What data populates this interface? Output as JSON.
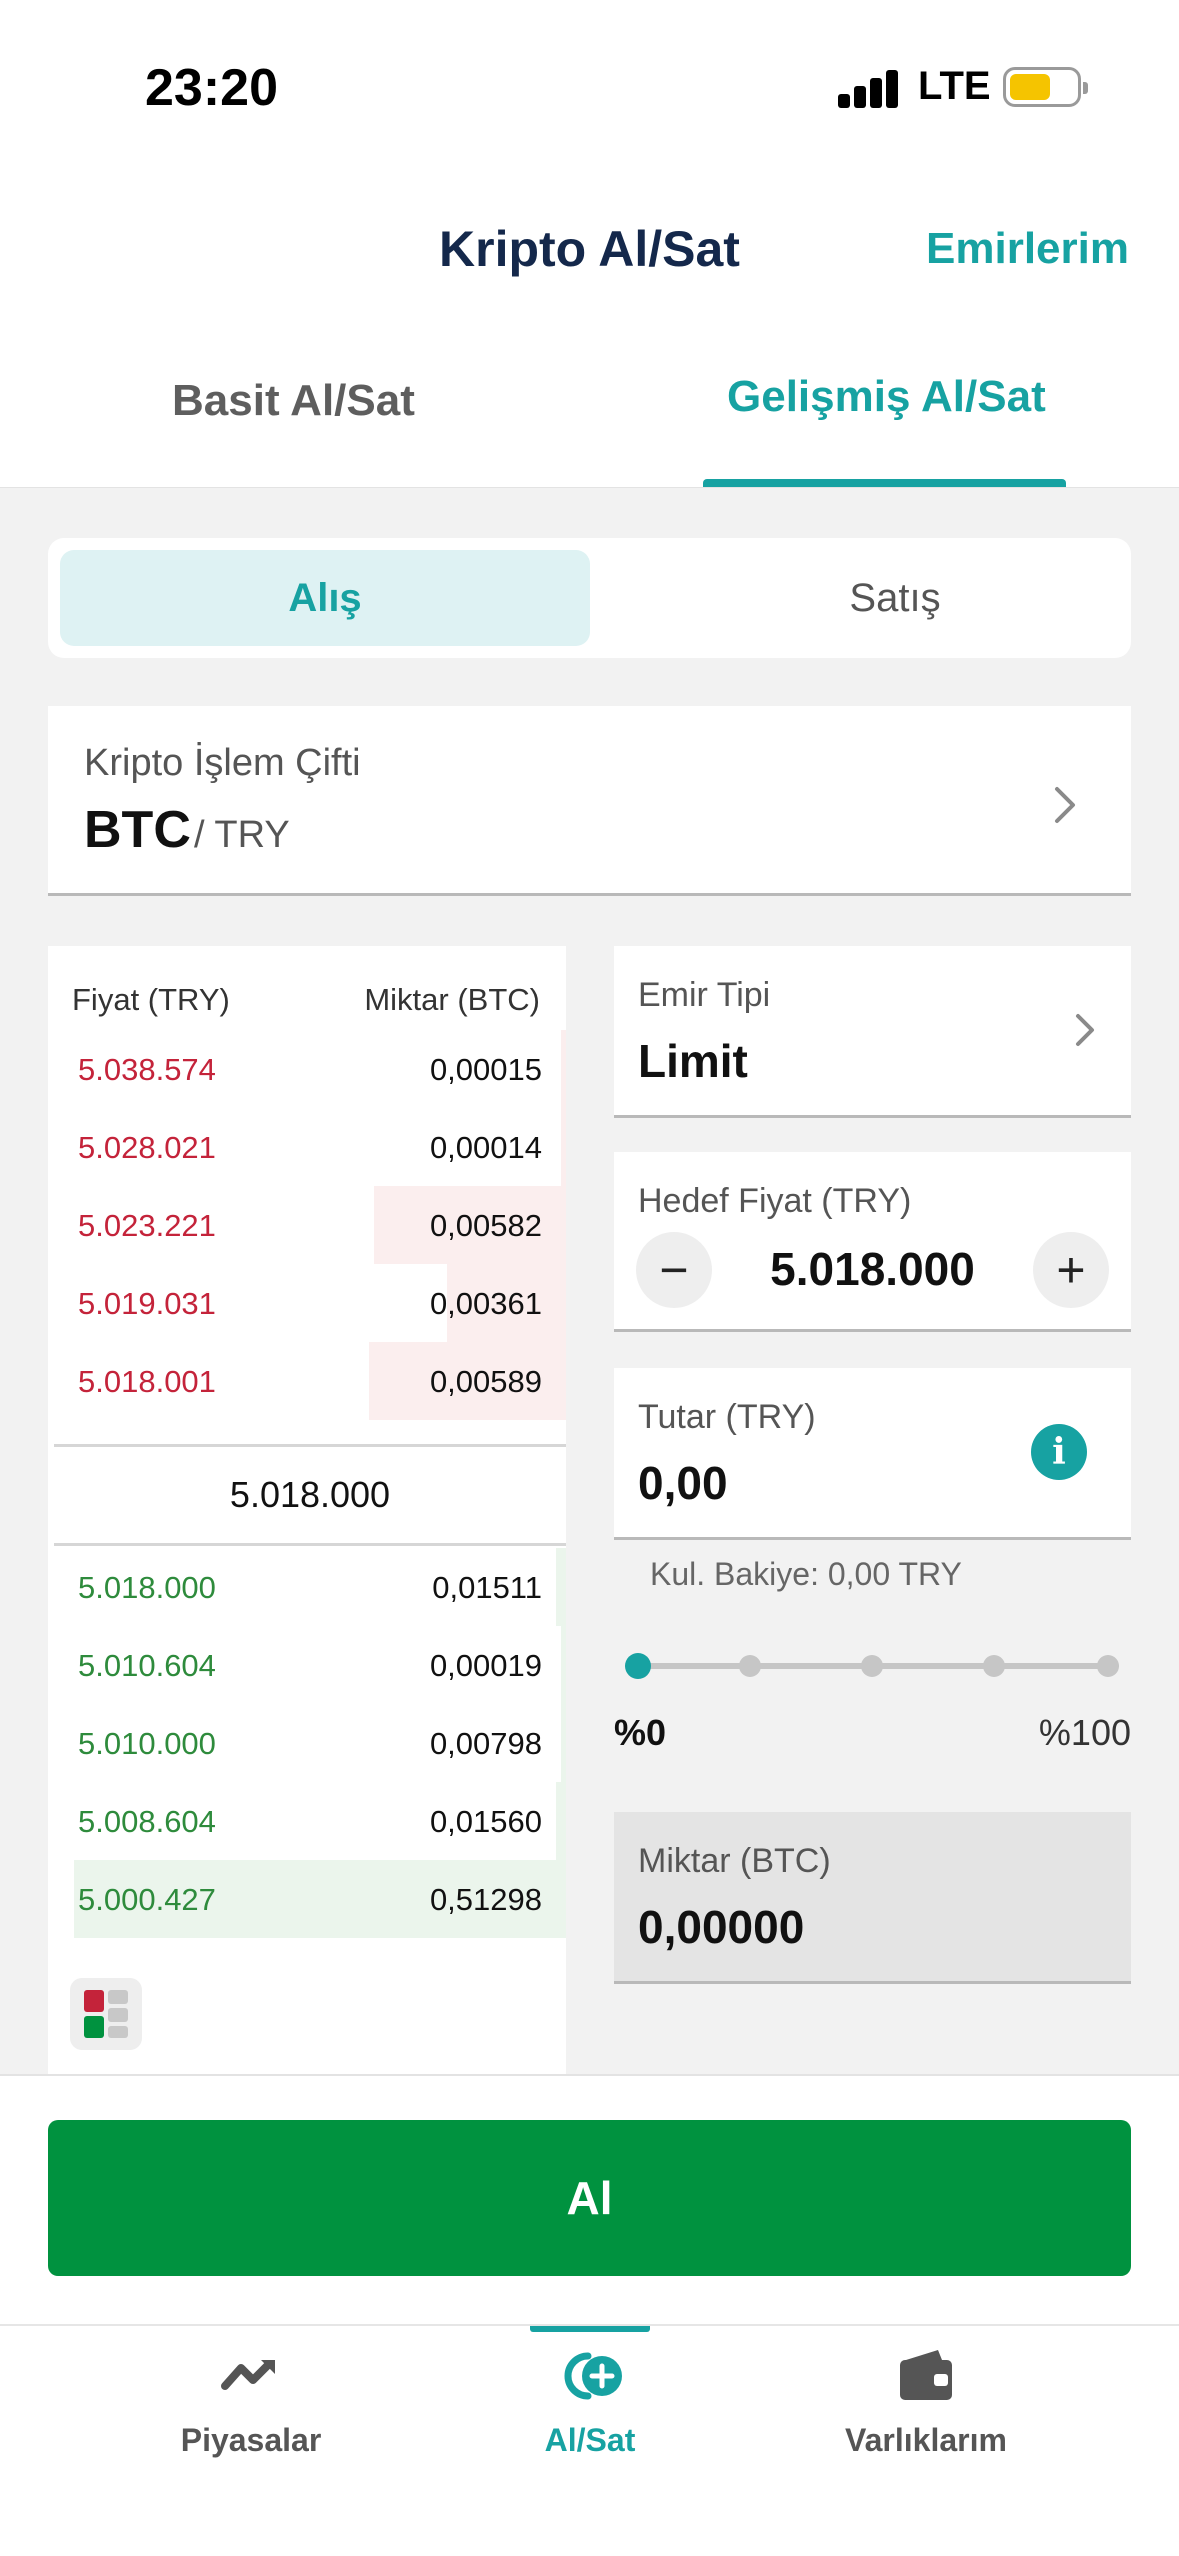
{
  "status_bar": {
    "time": "23:20",
    "network": "LTE",
    "battery_level": 0.6
  },
  "header": {
    "title": "Kripto Al/Sat",
    "orders_link": "Emirlerim"
  },
  "tabs": {
    "basic": "Basit Al/Sat",
    "advanced": "Gelişmiş Al/Sat",
    "active": "advanced"
  },
  "segment": {
    "buy": "Alış",
    "sell": "Satış",
    "active": "buy"
  },
  "pair": {
    "label": "Kripto İşlem Çifti",
    "base": "BTC",
    "quote": "/ TRY"
  },
  "order_book": {
    "price_header": "Fiyat (TRY)",
    "qty_header": "Miktar (BTC)",
    "asks": [
      {
        "price": "5.038.574",
        "qty": "0,00015",
        "depth": 0.01
      },
      {
        "price": "5.028.021",
        "qty": "0,00014",
        "depth": 0.01
      },
      {
        "price": "5.023.221",
        "qty": "0,00582",
        "depth": 0.37
      },
      {
        "price": "5.019.031",
        "qty": "0,00361",
        "depth": 0.23
      },
      {
        "price": "5.018.001",
        "qty": "0,00589",
        "depth": 0.38
      }
    ],
    "mid_price": "5.018.000",
    "bids": [
      {
        "price": "5.018.000",
        "qty": "0,01511",
        "depth": 0.02
      },
      {
        "price": "5.010.604",
        "qty": "0,00019",
        "depth": 0.01
      },
      {
        "price": "5.010.000",
        "qty": "0,00798",
        "depth": 0.01
      },
      {
        "price": "5.008.604",
        "qty": "0,01560",
        "depth": 0.02
      },
      {
        "price": "5.000.427",
        "qty": "0,51298",
        "depth": 0.95
      }
    ]
  },
  "order_type": {
    "label": "Emir Tipi",
    "value": "Limit"
  },
  "target_price": {
    "label": "Hedef Fiyat (TRY)",
    "value": "5.018.000",
    "minus": "−",
    "plus": "+"
  },
  "amount": {
    "label": "Tutar (TRY)",
    "value": "0,00",
    "info": "i"
  },
  "balance": "Kul. Bakiye: 0,00 TRY",
  "slider": {
    "min_label": "%0",
    "max_label": "%100",
    "value": 0
  },
  "quantity": {
    "label": "Miktar (BTC)",
    "value": "0,00000"
  },
  "action": {
    "buy_label": "Al"
  },
  "nav": {
    "items": [
      {
        "label": "Piyasalar",
        "icon": "market-trend-icon"
      },
      {
        "label": "Al/Sat",
        "icon": "buy-sell-icon"
      },
      {
        "label": "Varlıklarım",
        "icon": "wallet-icon"
      }
    ],
    "active": 1
  },
  "colors": {
    "accent": "#17a2a2",
    "buy": "#00923f",
    "ask": "#c4233a",
    "bid": "#2e8b3c",
    "title": "#14284b"
  }
}
